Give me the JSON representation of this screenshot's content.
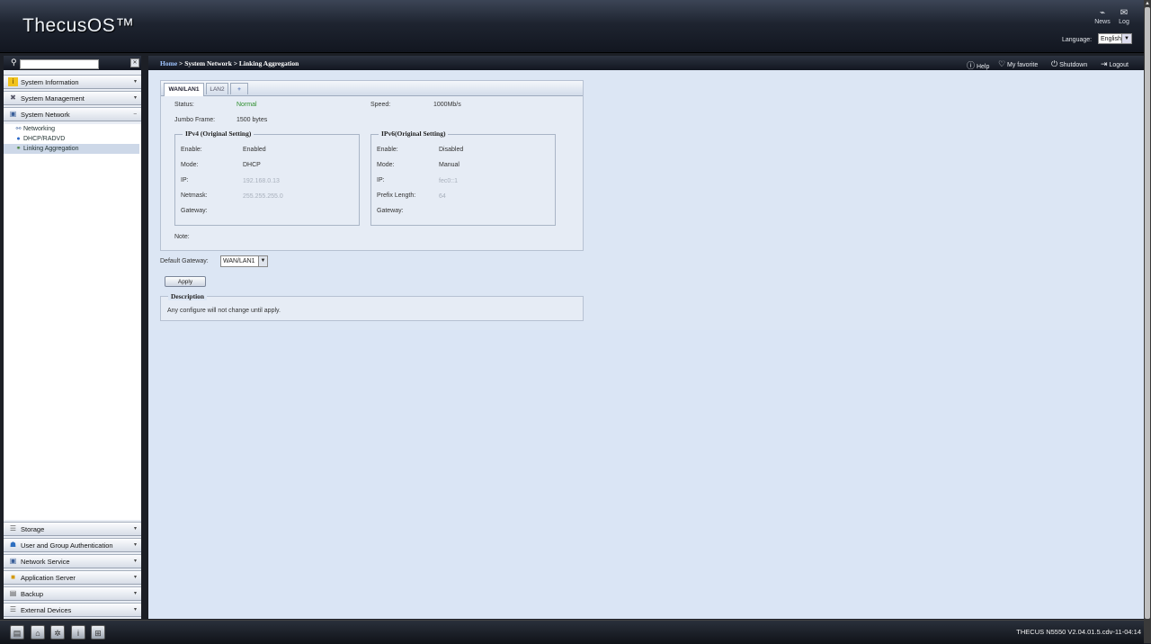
{
  "header": {
    "logo": "ThecusOS™",
    "news_label": "News",
    "log_label": "Log",
    "language_label": "Language:",
    "language_value": "English"
  },
  "sidebar": {
    "top_menus": [
      {
        "label": "System Information",
        "icon": "info-icon"
      },
      {
        "label": "System Management",
        "icon": "tools-icon"
      },
      {
        "label": "System Network",
        "icon": "network-icon"
      }
    ],
    "submenu": [
      {
        "label": "Networking",
        "icon": "network-cable-icon"
      },
      {
        "label": "DHCP/RADVD",
        "icon": "globe-icon"
      },
      {
        "label": "Linking Aggregation",
        "icon": "link-aggregation-icon"
      }
    ],
    "bottom_menus": [
      {
        "label": "Storage",
        "icon": "storage-icon"
      },
      {
        "label": "User and Group Authentication",
        "icon": "users-icon"
      },
      {
        "label": "Network Service",
        "icon": "network-service-icon"
      },
      {
        "label": "Application Server",
        "icon": "app-server-icon"
      },
      {
        "label": "Backup",
        "icon": "backup-icon"
      },
      {
        "label": "External Devices",
        "icon": "external-devices-icon"
      }
    ]
  },
  "topbar": {
    "breadcrumb_home": "Home",
    "breadcrumb_rest": " > System Network > Linking Aggregation",
    "help": "Help",
    "favorite": "My favorite",
    "shutdown": "Shutdown",
    "logout": "Logout"
  },
  "tabs": [
    "WAN/LAN1",
    "LAN2",
    "+"
  ],
  "panel": {
    "status_label": "Status:",
    "status_value": "Normal",
    "speed_label": "Speed:",
    "speed_value": "1000Mb/s",
    "jumbo_label": "Jumbo Frame:",
    "jumbo_value": "1500 bytes",
    "ipv4": {
      "title": "IPv4 (Original Setting)",
      "enable_label": "Enable:",
      "enable_value": "Enabled",
      "mode_label": "Mode:",
      "mode_value": "DHCP",
      "ip_label": "IP:",
      "ip_value": "192.168.0.13",
      "netmask_label": "Netmask:",
      "netmask_value": "255.255.255.0",
      "gateway_label": "Gateway:",
      "gateway_value": ""
    },
    "ipv6": {
      "title": "IPv6(Original Setting)",
      "enable_label": "Enable:",
      "enable_value": "Disabled",
      "mode_label": "Mode:",
      "mode_value": "Manual",
      "ip_label": "IP:",
      "ip_value": "fec0::1",
      "prefix_label": "Prefix Length:",
      "prefix_value": "64",
      "gateway_label": "Gateway:",
      "gateway_value": ""
    },
    "note_label": "Note:"
  },
  "default_gateway": {
    "label": "Default Gateway:",
    "value": "WAN/LAN1"
  },
  "apply_label": "Apply",
  "description": {
    "title": "Description",
    "text": "Any configure will not change until apply."
  },
  "footer": {
    "version": "THECUS N5550 V2.04.01.5.cdv-11-04:14"
  }
}
